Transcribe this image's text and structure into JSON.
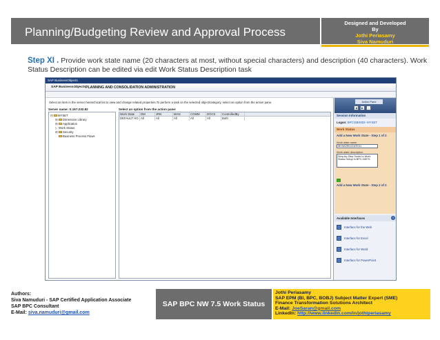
{
  "header": {
    "title": "Planning/Budgeting Review and Approval Process",
    "credit_line1": "Designed and Developed",
    "credit_line2": "By",
    "credit_name1": "Jothi Periasamy",
    "credit_name2": "Siva Namuduri"
  },
  "step": {
    "label": "Step XI .",
    "text": " Provide work state name (20 characters at most, without special characters) and description (40 characters). Work Status Description can be edited via edit Work Status Description task"
  },
  "screenshot": {
    "window_title": "SAP BusinessObjects",
    "logo_prefix": "SAP Business",
    "logo_suffix": "Objects",
    "admin_title": "PLANNING AND CONSOLIDATION ADMINISTRATION",
    "instruction": "Select an item in the server hierarchical list to view and change related properties.To perform a task on the selected object/category, select an option from the action pane.",
    "server_name": "Server name: S.167.232.82",
    "action_header": "Select an option from the action pane:",
    "tree": [
      {
        "glyph": "⊟",
        "label": "MYSET",
        "indent": 0,
        "folder": true
      },
      {
        "glyph": "⊞",
        "label": "Dimension Library",
        "indent": 1,
        "folder": true
      },
      {
        "glyph": "⊞",
        "label": "Application",
        "indent": 1,
        "folder": true
      },
      {
        "glyph": "▷",
        "label": "Work Status",
        "indent": 1,
        "folder": false
      },
      {
        "glyph": "⊞",
        "label": "Security",
        "indent": 1,
        "folder": true
      },
      {
        "glyph": " ",
        "label": "Business Process Flows",
        "indent": 1,
        "folder": true
      }
    ],
    "grid_columns": [
      "Work State",
      "DM",
      "JRN",
      "MAN",
      "COMM",
      "DOCS",
      "ControlledBy"
    ],
    "grid_rows": [
      [
        "DEFAULT HO",
        "All",
        "All",
        "All",
        "All",
        "All",
        "Both"
      ]
    ],
    "pane": {
      "tab_label": "Action Pane",
      "btn_back": "◀",
      "btn_fwd": "▶",
      "btn_home": "⌂",
      "session_header": "Session Information",
      "logon_label": "Logon:",
      "logon_value": "BPC\\SBX002- MYSET",
      "ws_header": "Work Status",
      "ws_step1": "Add a New Work State - Step 1 of 2",
      "ws_name_label": "Work state name",
      "ws_name_value": "MYWORKSTATE01",
      "ws_desc_label": "Work state description",
      "ws_desc_value": "Step-by-Step Guide to Work Status Setup in BPC-NW75",
      "ws_next": "→",
      "ws_step2": "Add a New Work State - Step 2 of 2",
      "ai_header": "Available Interfaces",
      "ai_info": "i",
      "interfaces": [
        "Interface for the Web",
        "Interface for Excel",
        "Interface for Word",
        "Interface for PowerPoint"
      ]
    }
  },
  "footer": {
    "left_line1": "Authors:",
    "left_line2": "Siva Namuduri - SAP Certified Application Associate",
    "left_line3": "SAP BPC Consultant",
    "left_email_label": "E-Mail: ",
    "left_email": "siva.namuduri@gmail.com",
    "center": "SAP BPC NW 7.5 Work Status",
    "right_line1": "Jothi Periasamy",
    "right_line2": "SAP EPM (BI, BPC, BOBJ) Subject Matter Expert (SME)",
    "right_line3": "Finance Transformation Solutions Architect",
    "right_email_label": "E-Mail: ",
    "right_email": "JoeSaran@gmail.com",
    "right_linkedin_label": "LinkedIn: ",
    "right_linkedin": "http://www.linkedin.com/in/jothiperiasamy"
  }
}
